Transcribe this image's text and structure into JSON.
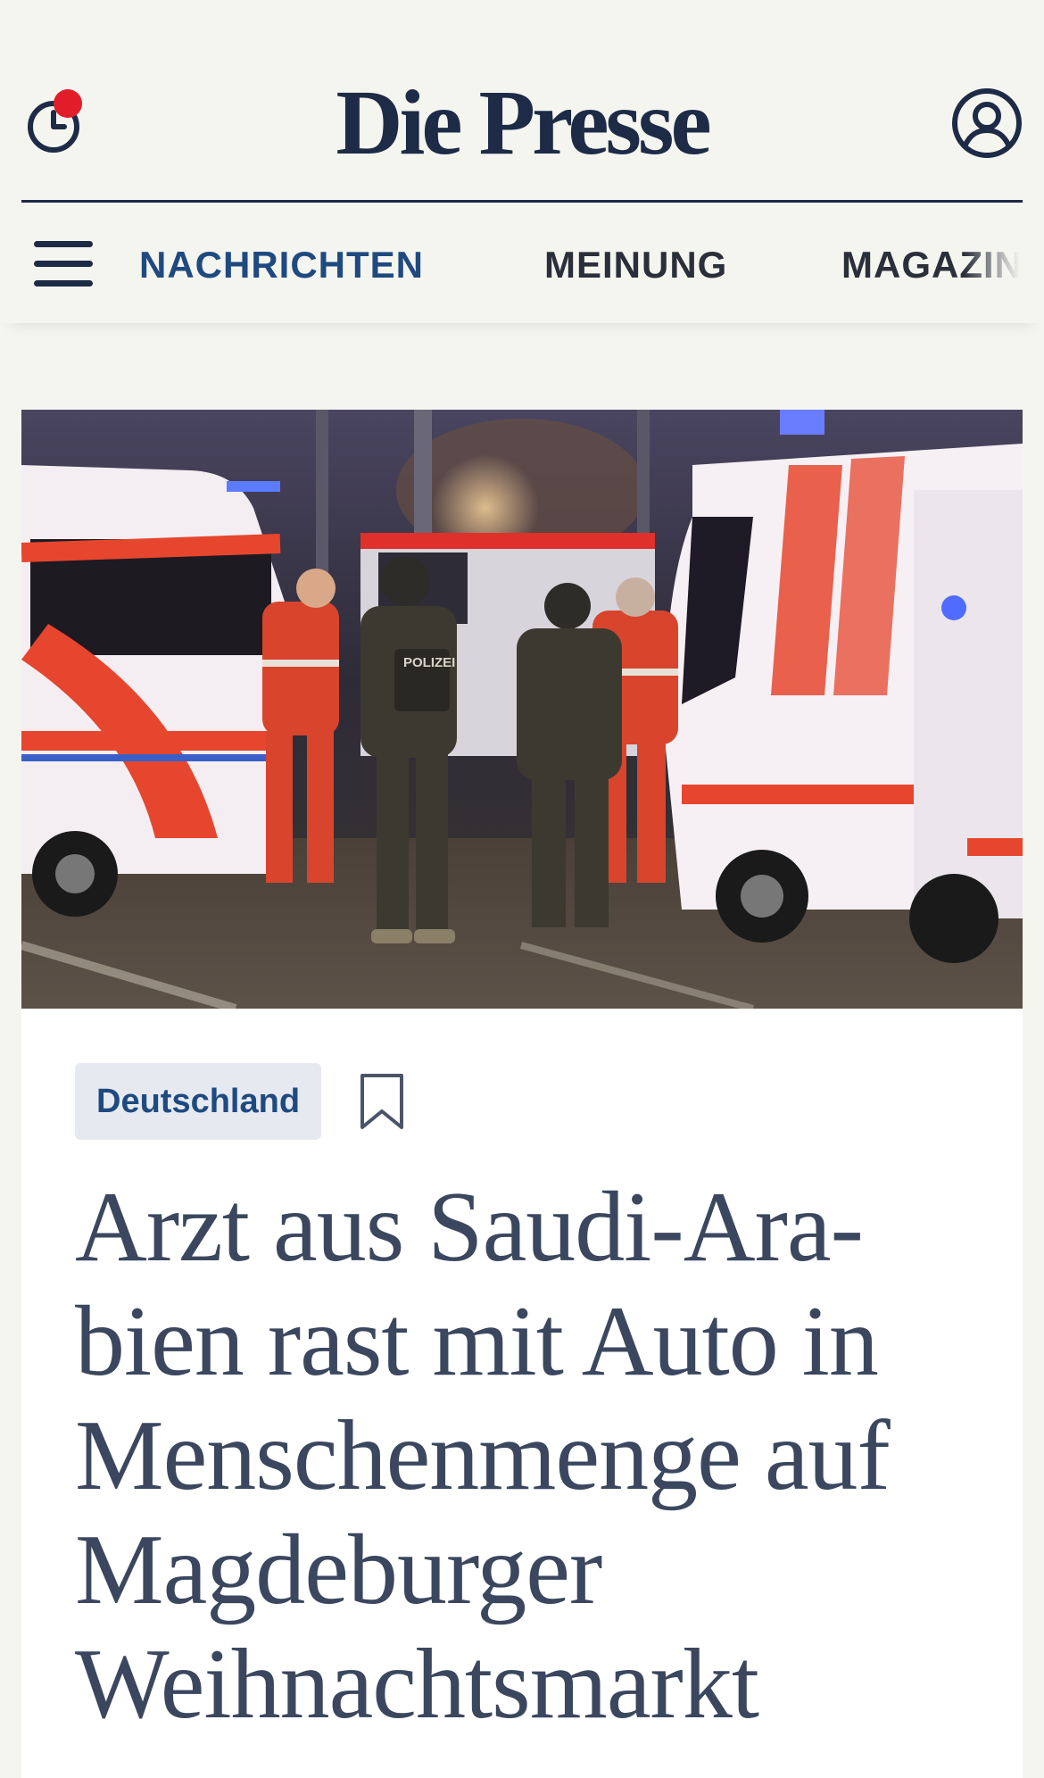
{
  "header": {
    "logo": "Die Presse",
    "history_has_notification": true
  },
  "nav": {
    "items": [
      {
        "label": "NACHRICHTEN",
        "active": true
      },
      {
        "label": "MEINUNG",
        "active": false
      },
      {
        "label": "MAGAZIN",
        "active": false
      }
    ]
  },
  "article": {
    "category": "Deutschland",
    "headline": "Arzt aus Saudi-Ara­bien rast mit Auto in Menschenmenge auf Magdeburger Weihnachtsmarkt",
    "image_alt": "Einsatzkräfte und Polizei vor Rettungswagen bei Nacht"
  },
  "icons": {
    "history": "history-clock-icon",
    "account": "user-account-icon",
    "menu": "hamburger-menu-icon",
    "bookmark": "bookmark-icon"
  },
  "colors": {
    "background": "#f5f5f0",
    "brand_navy": "#1d2b46",
    "active_nav": "#1f4a80",
    "headline": "#3b475e",
    "notification": "#e11d2a",
    "tag_bg": "#e6eaf0"
  }
}
